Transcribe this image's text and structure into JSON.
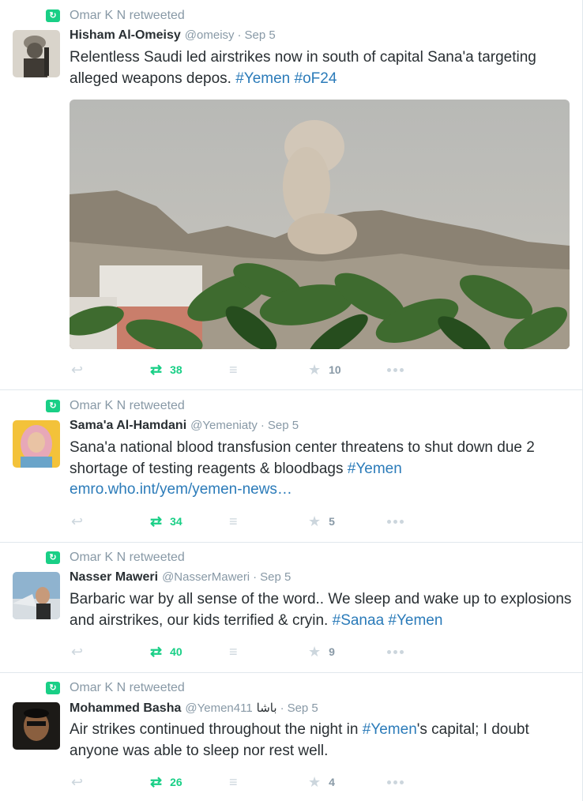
{
  "tweets": [
    {
      "retweeted_by": "Omar K N retweeted",
      "fullname": "Hisham Al-Omeisy",
      "username": "@omeisy",
      "time": "Sep 5",
      "text_plain": "Relentless Saudi led airstrikes now in south of capital Sana'a targeting alleged weapons depos. ",
      "hashtags": [
        "#Yemen",
        "#oF24"
      ],
      "retweet_count": "38",
      "favorite_count": "10",
      "has_media": true
    },
    {
      "retweeted_by": "Omar K N retweeted",
      "fullname": "Sama'a Al-Hamdani",
      "username": "@Yemeniaty",
      "time": "Sep 5",
      "text_plain": "Sana'a national blood transfusion center threatens to shut down due 2 shortage of testing reagents & bloodbags ",
      "hashtags": [
        "#Yemen"
      ],
      "link": "emro.who.int/yem/yemen-news…",
      "retweet_count": "34",
      "favorite_count": "5",
      "has_media": false
    },
    {
      "retweeted_by": "Omar K N retweeted",
      "fullname": "Nasser Maweri",
      "username": "@NasserMaweri",
      "time": "Sep 5",
      "text_plain": "Barbaric war by all sense of the word.. We sleep and wake up to explosions and airstrikes, our kids terrified & cryin. ",
      "hashtags": [
        "#Sanaa",
        "#Yemen"
      ],
      "retweet_count": "40",
      "favorite_count": "9",
      "has_media": false
    },
    {
      "retweeted_by": "Omar K N retweeted",
      "fullname": "Mohammed Basha",
      "username": "@Yemen411",
      "extra": "باشا",
      "time": "Sep 5",
      "text_before": "Air strikes continued throughout the night in ",
      "hashtags": [
        "#Yemen"
      ],
      "text_after": "'s capital; I doubt anyone was able to sleep nor rest well.",
      "retweet_count": "26",
      "favorite_count": "4",
      "has_media": false
    }
  ],
  "icons": {
    "retweet_badge": "retweet-badge-icon",
    "reply": "reply-icon",
    "retweet": "retweet-icon",
    "stack": "stack-icon",
    "favorite": "star-icon",
    "more": "more-icon"
  },
  "colors": {
    "link": "#2b7bb9",
    "retweet_green": "#19cf86",
    "muted": "#8899a6",
    "icon_gray": "#ccd6dd",
    "text": "#292f33"
  }
}
